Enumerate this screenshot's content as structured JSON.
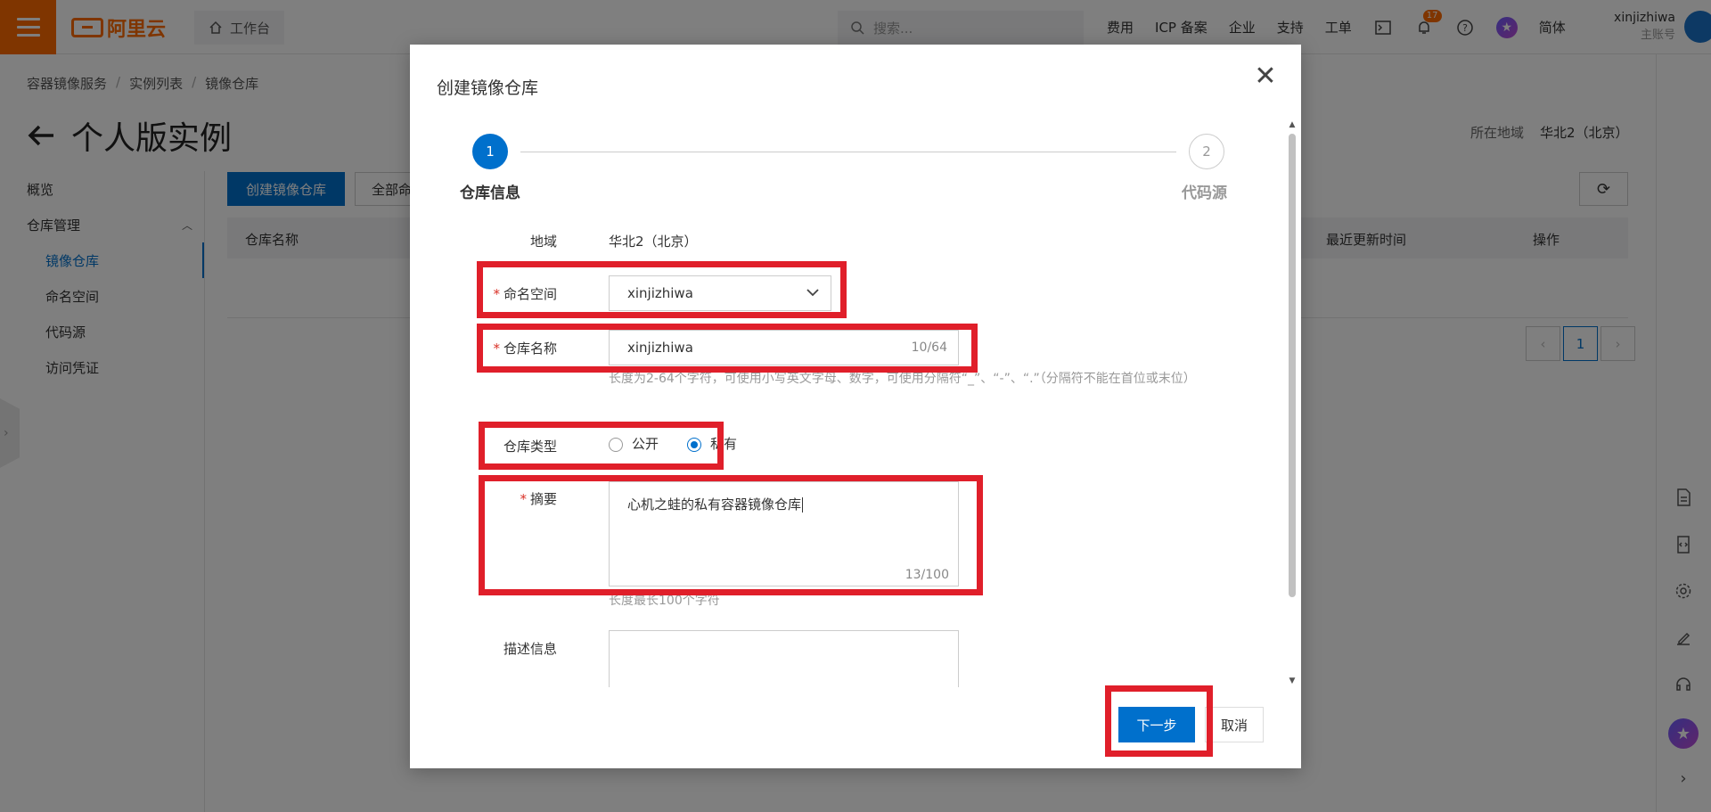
{
  "topbar": {
    "logo_text": "阿里云",
    "workbench_label": "工作台",
    "search_placeholder": "搜索...",
    "nav_items": [
      "费用",
      "ICP 备案",
      "企业",
      "支持",
      "工单"
    ],
    "notification_count": "17",
    "language": "简体",
    "account_name": "xinjizhiwa",
    "account_type": "主账号"
  },
  "page": {
    "breadcrumb": [
      "容器镜像服务",
      "实例列表",
      "镜像仓库"
    ],
    "title": "个人版实例",
    "region_label": "所在地域",
    "region_value": "华北2（北京）",
    "create_button": "创建镜像仓库",
    "all_button": "全部命",
    "table_headers": {
      "name": "仓库名称",
      "updated": "最近更新时间",
      "actions": "操作"
    },
    "pagination_current": "1"
  },
  "sidenav": {
    "overview": "概览",
    "repo_mgmt": "仓库管理",
    "image_repo": "镜像仓库",
    "namespace": "命名空间",
    "code_source": "代码源",
    "credentials": "访问凭证"
  },
  "dialog": {
    "title": "创建镜像仓库",
    "steps": [
      {
        "number": "1",
        "label": "仓库信息"
      },
      {
        "number": "2",
        "label": "代码源"
      }
    ],
    "region_label": "地域",
    "region_value": "华北2（北京）",
    "namespace_label": "命名空间",
    "namespace_value": "xinjizhiwa",
    "repo_name_label": "仓库名称",
    "repo_name_value": "xinjizhiwa",
    "repo_name_count": "10/64",
    "repo_name_help": "长度为2-64个字符，可使用小写英文字母、数字，可使用分隔符“_”、“-”、“.”（分隔符不能在首位或末位）",
    "repo_type_label": "仓库类型",
    "repo_type_options": [
      "公开",
      "私有"
    ],
    "repo_type_selected": "私有",
    "summary_label": "摘要",
    "summary_value": "心机之蛙的私有容器镜像仓库",
    "summary_count": "13/100",
    "summary_help": "长度最长100个字符",
    "description_label": "描述信息",
    "next_button": "下一步",
    "cancel_button": "取消"
  },
  "colors": {
    "brand_orange": "#ff6a00",
    "primary_blue": "#0070cc",
    "highlight_red": "#e01f2a"
  }
}
